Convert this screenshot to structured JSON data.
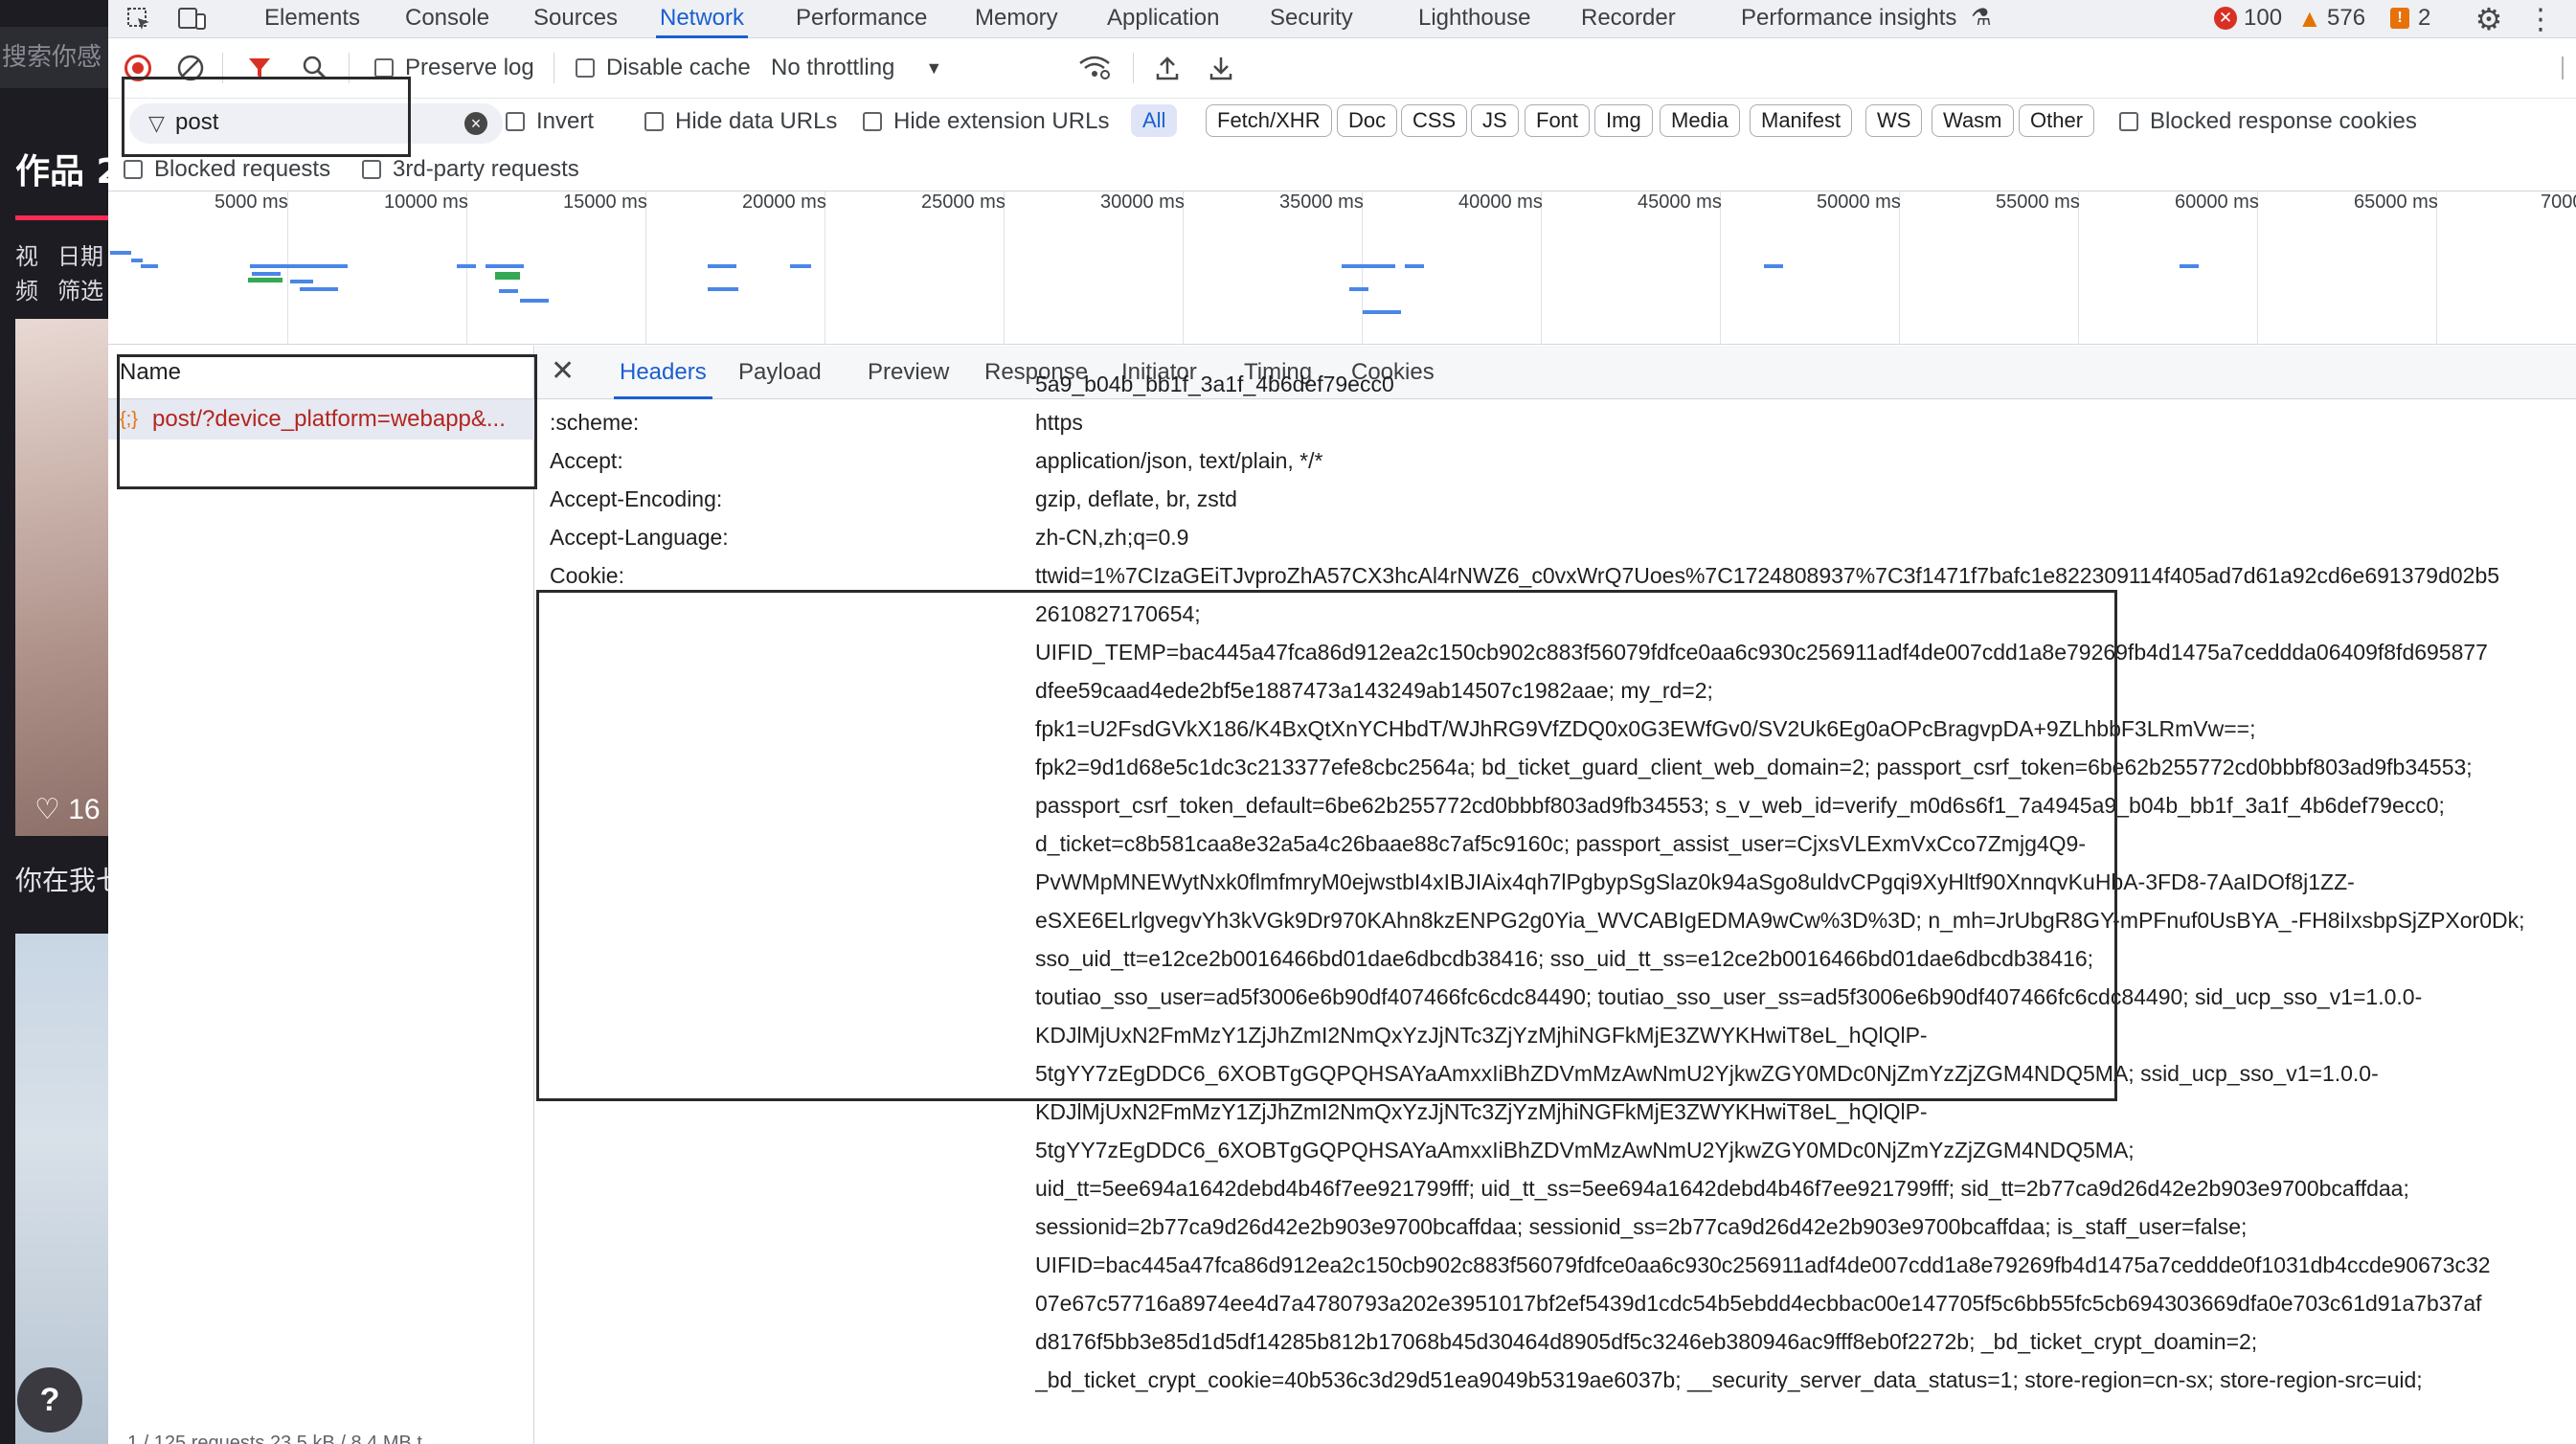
{
  "background_page": {
    "search_placeholder": "搜索你感",
    "title": "作品 2",
    "tab_1_line1": "视",
    "tab_1_line2": "频",
    "tab_2_line1": "日期",
    "tab_2_line2": "筛选",
    "like_count": "16",
    "caption": "你在我七",
    "help": "?"
  },
  "devtools": {
    "tabs": [
      "Elements",
      "Console",
      "Sources",
      "Network",
      "Performance",
      "Memory",
      "Application",
      "Security",
      "Lighthouse",
      "Recorder",
      "Performance insights"
    ],
    "active_tab": "Network",
    "errors": "100",
    "warnings": "576",
    "issues": "2",
    "toolbar": {
      "preserve_log": "Preserve log",
      "disable_cache": "Disable cache",
      "throttling": "No throttling"
    },
    "filter": {
      "value": "post",
      "invert": "Invert",
      "hide_data_urls": "Hide data URLs",
      "hide_extension_urls": "Hide extension URLs",
      "types": [
        "All",
        "Fetch/XHR",
        "Doc",
        "CSS",
        "JS",
        "Font",
        "Img",
        "Media",
        "Manifest",
        "WS",
        "Wasm",
        "Other"
      ],
      "active_type": "All",
      "blocked_response_cookies": "Blocked response cookies",
      "blocked_requests": "Blocked requests",
      "third_party_requests": "3rd-party requests"
    },
    "overview_ticks": [
      "5000 ms",
      "10000 ms",
      "15000 ms",
      "20000 ms",
      "25000 ms",
      "30000 ms",
      "35000 ms",
      "40000 ms",
      "45000 ms",
      "50000 ms",
      "55000 ms",
      "60000 ms",
      "65000 ms",
      "7000"
    ],
    "request_list": {
      "header": "Name",
      "request_name": "post/?device_platform=webapp&...",
      "footer": "1 / 125 requests   23.5 kB / 8.4 MB t"
    },
    "detail_tabs": [
      "Headers",
      "Payload",
      "Preview",
      "Response",
      "Initiator",
      "Timing",
      "Cookies"
    ],
    "active_detail_tab": "Headers",
    "headers": [
      {
        "key": "",
        "value": "5a9_b04b_bb1f_3a1f_4b6def79ecc0"
      },
      {
        "key": ":scheme:",
        "value": "https"
      },
      {
        "key": "Accept:",
        "value": "application/json, text/plain, */*"
      },
      {
        "key": "Accept-Encoding:",
        "value": "gzip, deflate, br, zstd"
      },
      {
        "key": "Accept-Language:",
        "value": "zh-CN,zh;q=0.9"
      },
      {
        "key": "Cookie:",
        "value": "ttwid=1%7CIzaGEiTJvproZhA57CX3hcAl4rNWZ6_c0vxWrQ7Uoes%7C1724808937%7C3f1471f7bafc1e822309114f405ad7d61a92cd6e691379d02b5"
      },
      {
        "key": "",
        "value": "2610827170654;"
      },
      {
        "key": "",
        "value": "UIFID_TEMP=bac445a47fca86d912ea2c150cb902c883f56079fdfce0aa6c930c256911adf4de007cdd1a8e79269fb4d1475a7ceddda06409f8fd695877"
      },
      {
        "key": "",
        "value": "dfee59caad4ede2bf5e1887473a143249ab14507c1982aae; my_rd=2;"
      },
      {
        "key": "",
        "value": "fpk1=U2FsdGVkX186/K4BxQtXnYCHbdT/WJhRG9VfZDQ0x0G3EWfGv0/SV2Uk6Eg0aOPcBragvpDA+9ZLhbbF3LRmVw==;"
      },
      {
        "key": "",
        "value": "fpk2=9d1d68e5c1dc3c213377efe8cbc2564a; bd_ticket_guard_client_web_domain=2; passport_csrf_token=6be62b255772cd0bbbf803ad9fb34553;"
      },
      {
        "key": "",
        "value": "passport_csrf_token_default=6be62b255772cd0bbbf803ad9fb34553; s_v_web_id=verify_m0d6s6f1_7a4945a9_b04b_bb1f_3a1f_4b6def79ecc0;"
      },
      {
        "key": "",
        "value": "d_ticket=c8b581caa8e32a5a4c26baae88c7af5c9160c; passport_assist_user=CjxsVLExmVxCco7Zmjg4Q9-"
      },
      {
        "key": "",
        "value": "PvWMpMNEWytNxk0flmfmryM0ejwstbI4xIBJIAix4qh7lPgbypSgSlaz0k94aSgo8uldvCPgqi9XyHltf90XnnqvKuHbA-3FD8-7AaIDOf8j1ZZ-"
      },
      {
        "key": "",
        "value": "eSXE6ELrlgvegvYh3kVGk9Dr970KAhn8kzENPG2g0Yia_WVCABIgEDMA9wCw%3D%3D; n_mh=JrUbgR8GY-mPFnuf0UsBYA_-FH8iIxsbpSjZPXor0Dk;"
      },
      {
        "key": "",
        "value": "sso_uid_tt=e12ce2b0016466bd01dae6dbcdb38416; sso_uid_tt_ss=e12ce2b0016466bd01dae6dbcdb38416;"
      },
      {
        "key": "",
        "value": "toutiao_sso_user=ad5f3006e6b90df407466fc6cdc84490; toutiao_sso_user_ss=ad5f3006e6b90df407466fc6cdc84490; sid_ucp_sso_v1=1.0.0-"
      },
      {
        "key": "",
        "value": "KDJlMjUxN2FmMzY1ZjJhZmI2NmQxYzJjNTc3ZjYzMjhiNGFkMjE3ZWYKHwiT8eL_hQlQlP-"
      },
      {
        "key": "",
        "value": "5tgYY7zEgDDC6_6XOBTgGQPQHSAYaAmxxIiBhZDVmMzAwNmU2YjkwZGY0MDc0NjZmYzZjZGM4NDQ5MA; ssid_ucp_sso_v1=1.0.0-"
      },
      {
        "key": "",
        "value": "KDJlMjUxN2FmMzY1ZjJhZmI2NmQxYzJjNTc3ZjYzMjhiNGFkMjE3ZWYKHwiT8eL_hQlQlP-"
      },
      {
        "key": "",
        "value": "5tgYY7zEgDDC6_6XOBTgGQPQHSAYaAmxxIiBhZDVmMzAwNmU2YjkwZGY0MDc0NjZmYzZjZGM4NDQ5MA;"
      },
      {
        "key": "",
        "value": "uid_tt=5ee694a1642debd4b46f7ee921799fff; uid_tt_ss=5ee694a1642debd4b46f7ee921799fff; sid_tt=2b77ca9d26d42e2b903e9700bcaffdaa;"
      },
      {
        "key": "",
        "value": "sessionid=2b77ca9d26d42e2b903e9700bcaffdaa; sessionid_ss=2b77ca9d26d42e2b903e9700bcaffdaa; is_staff_user=false;"
      },
      {
        "key": "",
        "value": "UIFID=bac445a47fca86d912ea2c150cb902c883f56079fdfce0aa6c930c256911adf4de007cdd1a8e79269fb4d1475a7ceddde0f1031db4ccde90673c32"
      },
      {
        "key": "",
        "value": "07e67c57716a8974ee4d7a4780793a202e3951017bf2ef5439d1cdc54b5ebdd4ecbbac00e147705f5c6bb55fc5cb694303669dfa0e703c61d91a7b37af"
      },
      {
        "key": "",
        "value": "d8176f5bb3e85d1d5df14285b812b17068b45d30464d8905df5c3246eb380946ac9fff8eb0f2272b; _bd_ticket_crypt_doamin=2;"
      },
      {
        "key": "",
        "value": "_bd_ticket_crypt_cookie=40b536c3d29d51ea9049b5319ae6037b; __security_server_data_status=1; store-region=cn-sx; store-region-src=uid;"
      }
    ]
  },
  "colors": {
    "accent": "#1a5fd0",
    "error": "#d93025",
    "warning": "#e37400",
    "issue": "#e8710a"
  }
}
